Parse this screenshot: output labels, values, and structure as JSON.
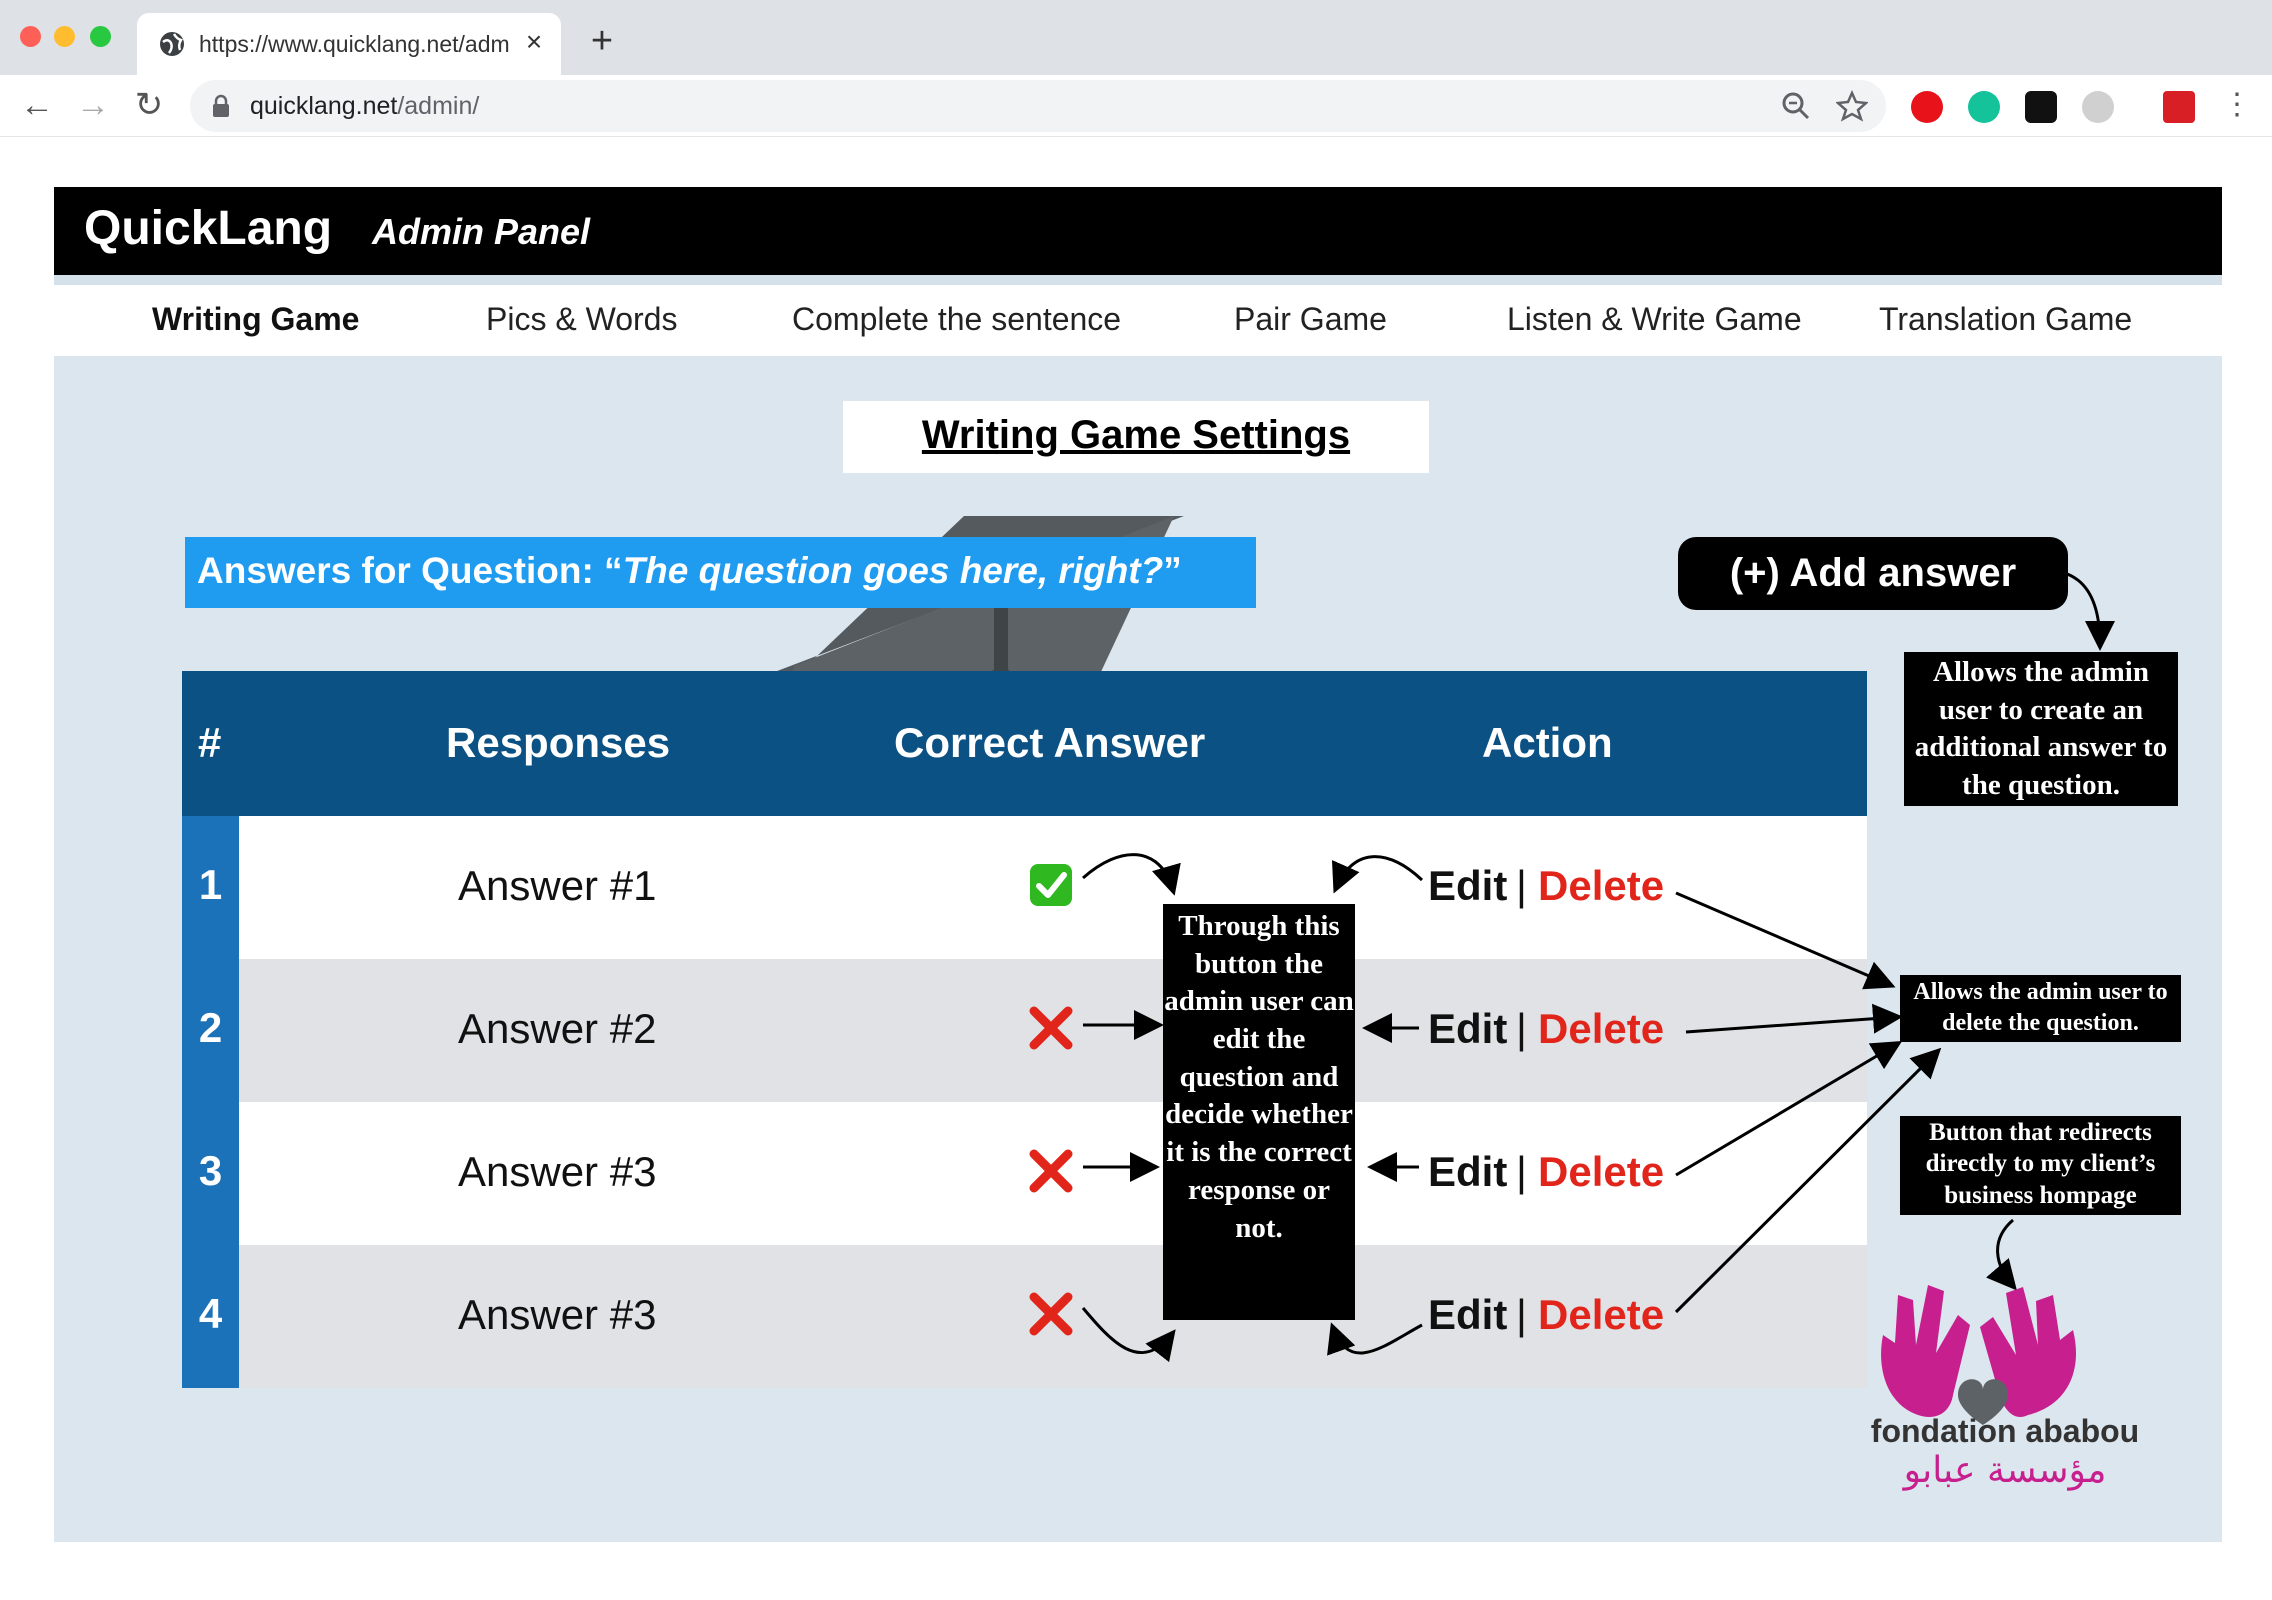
{
  "browser": {
    "tab_title": "https://www.quicklang.net/adm",
    "url_host": "quicklang.net",
    "url_path": "/admin/"
  },
  "header": {
    "brand": "QuickLang",
    "panel_label": "Admin Panel"
  },
  "nav": {
    "items": [
      {
        "label": "Writing Game",
        "active": true
      },
      {
        "label": "Pics & Words",
        "active": false
      },
      {
        "label": "Complete the sentence",
        "active": false
      },
      {
        "label": "Pair Game",
        "active": false
      },
      {
        "label": "Listen & Write Game",
        "active": false
      },
      {
        "label": "Translation Game",
        "active": false
      }
    ]
  },
  "page": {
    "title": "Writing Game Settings",
    "question_prefix": "Answers for Question: “",
    "question_text": "The question goes here, right?",
    "question_suffix": "”",
    "add_answer_label": "(+) Add answer"
  },
  "table": {
    "headers": {
      "num": "#",
      "responses": "Responses",
      "correct": "Correct Answer",
      "action": "Action"
    },
    "rows": [
      {
        "num": "1",
        "answer": "Answer #1",
        "correct": true
      },
      {
        "num": "2",
        "answer": "Answer #2",
        "correct": false
      },
      {
        "num": "3",
        "answer": "Answer #3",
        "correct": false
      },
      {
        "num": "4",
        "answer": "Answer #3",
        "correct": false
      }
    ],
    "edit_label": "Edit",
    "separator": "|",
    "delete_label": "Delete"
  },
  "annotations": {
    "add_note": "Allows the admin user to create an additional answer to the question.",
    "edit_note": "Through this button the admin user can edit the question and decide whether it is the correct response or not.",
    "delete_note": "Allows the admin user to delete the question.",
    "logo_note": "Button that redirects directly to my client’s business hompage"
  },
  "logo": {
    "name_latin": "fondation ababou",
    "name_arabic": "مؤسسة عبابو"
  },
  "colors": {
    "header_bg": "#000000",
    "question_bar": "#1f9bf0",
    "table_header": "#0b5183",
    "row_number": "#1b72b8",
    "delete": "#e1251b",
    "logo_magenta": "#c81f8e"
  }
}
